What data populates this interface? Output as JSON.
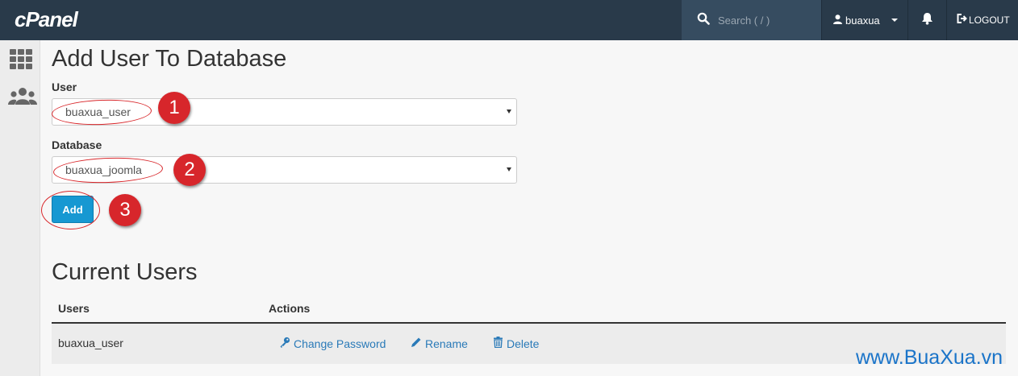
{
  "topbar": {
    "logo": "cPanel",
    "search_placeholder": "Search ( / )",
    "username": "buaxua",
    "logout_label": "LOGOUT"
  },
  "sidebar": {
    "items": [
      {
        "icon": "grid-icon"
      },
      {
        "icon": "users-icon"
      }
    ]
  },
  "main": {
    "title": "Add User To Database",
    "user_label": "User",
    "user_value": "buaxua_user",
    "database_label": "Database",
    "database_value": "buaxua_joomla",
    "add_button": "Add"
  },
  "annotations": [
    "1",
    "2",
    "3"
  ],
  "current_users": {
    "title": "Current Users",
    "columns": [
      "Users",
      "Actions"
    ],
    "rows": [
      {
        "user": "buaxua_user",
        "actions": {
          "change_password": "Change Password",
          "rename": "Rename",
          "delete": "Delete"
        }
      }
    ]
  },
  "watermark": "www.BuaXua.vn",
  "colors": {
    "topbar": "#293a4a",
    "accent": "#1798d2",
    "annotation": "#d7262b",
    "link": "#2a7ab8"
  }
}
